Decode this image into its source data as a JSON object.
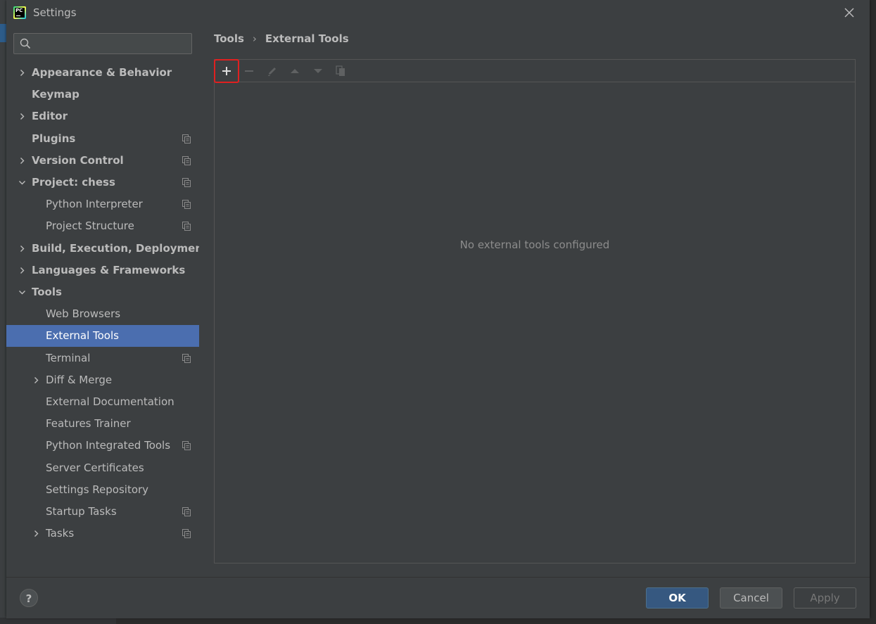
{
  "window": {
    "title": "Settings"
  },
  "search": {
    "placeholder": "",
    "value": ""
  },
  "sidebar": {
    "items": [
      {
        "label": "Appearance & Behavior",
        "bold": true,
        "arrow": "right",
        "indent": 0,
        "proj_icon": false,
        "selected": false
      },
      {
        "label": "Keymap",
        "bold": true,
        "arrow": "none",
        "indent": 0,
        "proj_icon": false,
        "selected": false
      },
      {
        "label": "Editor",
        "bold": true,
        "arrow": "right",
        "indent": 0,
        "proj_icon": false,
        "selected": false
      },
      {
        "label": "Plugins",
        "bold": true,
        "arrow": "none",
        "indent": 0,
        "proj_icon": true,
        "selected": false
      },
      {
        "label": "Version Control",
        "bold": true,
        "arrow": "right",
        "indent": 0,
        "proj_icon": true,
        "selected": false
      },
      {
        "label": "Project: chess",
        "bold": true,
        "arrow": "down",
        "indent": 0,
        "proj_icon": true,
        "selected": false
      },
      {
        "label": "Python Interpreter",
        "bold": false,
        "arrow": "none",
        "indent": 1,
        "proj_icon": true,
        "selected": false
      },
      {
        "label": "Project Structure",
        "bold": false,
        "arrow": "none",
        "indent": 1,
        "proj_icon": true,
        "selected": false
      },
      {
        "label": "Build, Execution, Deployment",
        "bold": true,
        "arrow": "right",
        "indent": 0,
        "proj_icon": false,
        "selected": false
      },
      {
        "label": "Languages & Frameworks",
        "bold": true,
        "arrow": "right",
        "indent": 0,
        "proj_icon": false,
        "selected": false
      },
      {
        "label": "Tools",
        "bold": true,
        "arrow": "down",
        "indent": 0,
        "proj_icon": false,
        "selected": false
      },
      {
        "label": "Web Browsers",
        "bold": false,
        "arrow": "none",
        "indent": 1,
        "proj_icon": false,
        "selected": false
      },
      {
        "label": "External Tools",
        "bold": false,
        "arrow": "none",
        "indent": 1,
        "proj_icon": false,
        "selected": true
      },
      {
        "label": "Terminal",
        "bold": false,
        "arrow": "none",
        "indent": 1,
        "proj_icon": true,
        "selected": false
      },
      {
        "label": "Diff & Merge",
        "bold": false,
        "arrow": "right",
        "indent": 1,
        "proj_icon": false,
        "selected": false
      },
      {
        "label": "External Documentation",
        "bold": false,
        "arrow": "none",
        "indent": 1,
        "proj_icon": false,
        "selected": false
      },
      {
        "label": "Features Trainer",
        "bold": false,
        "arrow": "none",
        "indent": 1,
        "proj_icon": false,
        "selected": false
      },
      {
        "label": "Python Integrated Tools",
        "bold": false,
        "arrow": "none",
        "indent": 1,
        "proj_icon": true,
        "selected": false
      },
      {
        "label": "Server Certificates",
        "bold": false,
        "arrow": "none",
        "indent": 1,
        "proj_icon": false,
        "selected": false
      },
      {
        "label": "Settings Repository",
        "bold": false,
        "arrow": "none",
        "indent": 1,
        "proj_icon": false,
        "selected": false
      },
      {
        "label": "Startup Tasks",
        "bold": false,
        "arrow": "none",
        "indent": 1,
        "proj_icon": true,
        "selected": false
      },
      {
        "label": "Tasks",
        "bold": false,
        "arrow": "right",
        "indent": 1,
        "proj_icon": true,
        "selected": false
      }
    ]
  },
  "breadcrumb": {
    "parent": "Tools",
    "separator": "›",
    "current": "External Tools"
  },
  "toolbar": {
    "buttons": [
      {
        "name": "add-icon",
        "enabled": true,
        "highlighted": true
      },
      {
        "name": "remove-icon",
        "enabled": false
      },
      {
        "name": "edit-icon",
        "enabled": false
      },
      {
        "name": "move-up-icon",
        "enabled": false
      },
      {
        "name": "move-down-icon",
        "enabled": false
      },
      {
        "name": "copy-icon",
        "enabled": false
      }
    ]
  },
  "main": {
    "empty_text": "No external tools configured"
  },
  "footer": {
    "help_label": "?",
    "ok_label": "OK",
    "cancel_label": "Cancel",
    "apply_label": "Apply"
  },
  "colors": {
    "background": "#3c3f41",
    "selection": "#4b6eaf",
    "ok_button": "#365880",
    "highlight_box": "#e02020"
  }
}
